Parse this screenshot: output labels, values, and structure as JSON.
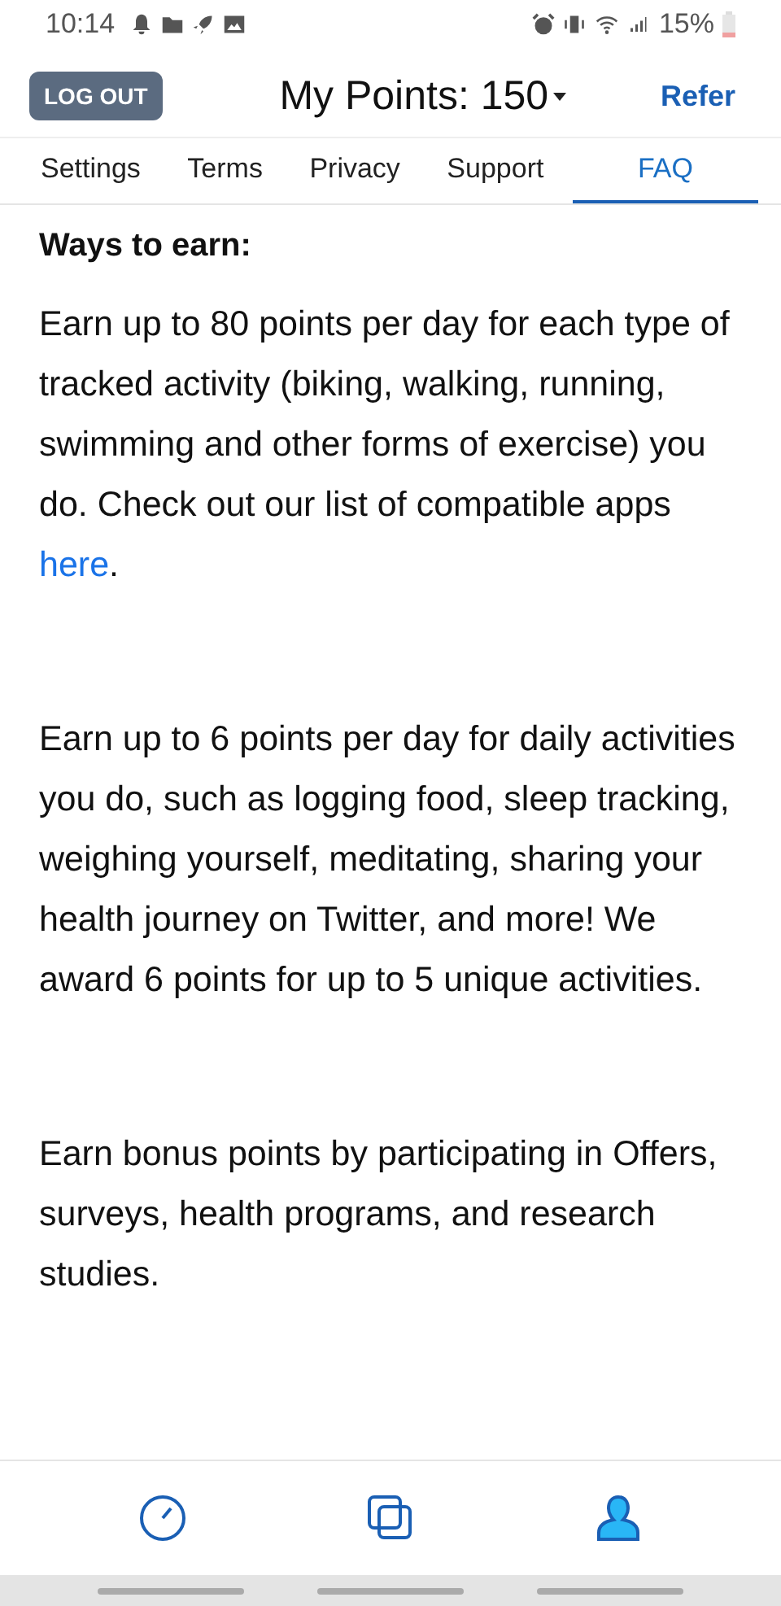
{
  "status_bar": {
    "time": "10:14",
    "battery": "15%"
  },
  "header": {
    "logout": "LOG OUT",
    "title": "My Points: 150",
    "refer": "Refer"
  },
  "tabs": [
    {
      "label": "Settings",
      "selected": false
    },
    {
      "label": "Terms",
      "selected": false
    },
    {
      "label": "Privacy",
      "selected": false
    },
    {
      "label": "Support",
      "selected": false
    },
    {
      "label": "FAQ",
      "selected": true
    }
  ],
  "heading": "Ways to earn:",
  "paragraphs": [
    {
      "text": "Earn up to 80 points per day for each type of tracked activity (biking, walking, running, swimming and other forms of exercise) you do. Check out our list of compatible apps ",
      "link": "here",
      "after": "."
    },
    {
      "text": "Earn up to 6 points per day for daily activities you do, such as logging food, sleep tracking, weighing yourself, meditating, sharing your health journey on Twitter, and more! We award 6 points for up to 5 unique activities."
    },
    {
      "text": "Earn bonus points by participating in Offers, surveys, health programs, and research studies."
    }
  ],
  "bottom_nav": [
    {
      "kind": "gauge",
      "selected": false
    },
    {
      "kind": "squares",
      "selected": false
    },
    {
      "kind": "person",
      "selected": true
    }
  ]
}
